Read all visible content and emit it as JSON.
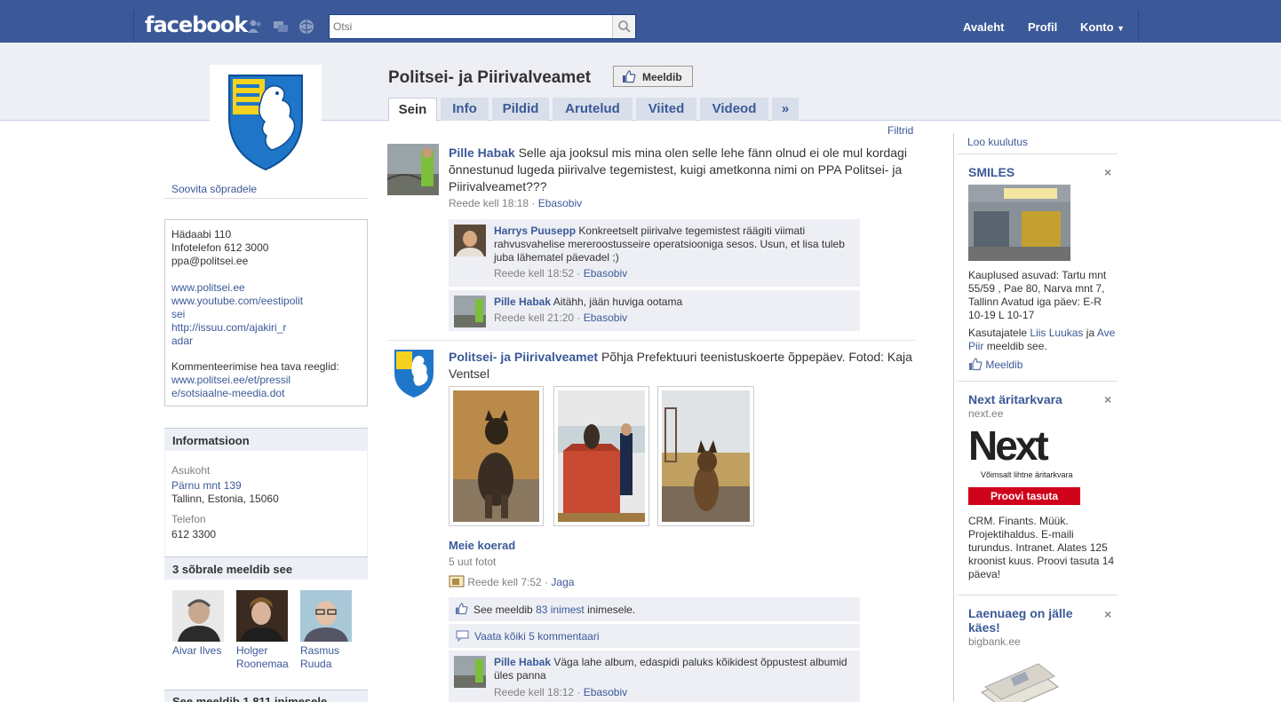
{
  "topbar": {
    "logo": "facebook",
    "search_placeholder": "Otsi",
    "nav": [
      "Avaleht",
      "Profil",
      "Konto"
    ]
  },
  "page": {
    "title": "Politsei- ja Piirivalveamet",
    "like_label": "Meeldib",
    "tabs": [
      "Sein",
      "Info",
      "Pildid",
      "Arutelud",
      "Viited",
      "Videod"
    ],
    "more_tab": "»",
    "filters": "Filtrid"
  },
  "left": {
    "suggest": "Soovita sõpradele",
    "contact": {
      "line1": "Hädaabi 110",
      "line2": "Infotelefon 612 3000",
      "line3": "ppa@politsei.ee",
      "link1": "www.politsei.ee",
      "link2a": "www.youtube.com/eestipolit",
      "link2b": "sei",
      "link3a": "http://issuu.com/ajakiri_r",
      "link3b": "adar",
      "rules_label": "Kommenteerimise hea tava reeglid:",
      "link4a": "www.politsei.ee/et/pressil",
      "link4b": "e/sotsiaalne-meedia.dot"
    },
    "info": {
      "heading": "Informatsioon",
      "location_label": "Asukoht",
      "street": "Pärnu mnt 139",
      "city": "Tallinn, Estonia, 15060",
      "phone_label": "Telefon",
      "phone": "612 3300"
    },
    "friends": {
      "heading": "3 sõbrale meeldib see",
      "people": [
        {
          "first": "Aivar Ilves",
          "second": ""
        },
        {
          "first": "Holger",
          "second": "Roonemaa"
        },
        {
          "first": "Rasmus",
          "second": "Ruuda"
        }
      ]
    },
    "likes_heading": "See meeldib 1 811 inimesele"
  },
  "feed": {
    "post1": {
      "author": "Pille Habak",
      "text": "Selle aja jooksul mis mina olen selle lehe fänn olnud ei ole mul kordagi õnnestunud lugeda piirivalve tegemistest, kuigi ametkonna nimi on PPA Politsei- ja Piirivalveamet???",
      "time": "Reede kell 18:18",
      "action": "Ebasobiv",
      "comments": [
        {
          "author": "Harrys Puusepp",
          "text": "Konkreetselt piirivalve tegemistest räägiti viimati rahvusvahelise mereroostusseire operatsiooniga sesos. Usun, et lisa tuleb juba lähematel päevadel ;)",
          "time": "Reede kell 18:52",
          "action": "Ebasobiv"
        },
        {
          "author": "Pille Habak",
          "text": "Aitähh, jään huviga ootama",
          "time": "Reede kell 21:20",
          "action": "Ebasobiv"
        }
      ]
    },
    "post2": {
      "author": "Politsei- ja Piirivalveamet",
      "text": "Põhja Prefektuuri teenistuskoerte õppepäev. Fotod: Kaja Ventsel",
      "album": "Meie koerad",
      "album_count": "5 uut fotot",
      "time": "Reede kell 7:52",
      "action": "Jaga",
      "likes_pre": "See meeldib",
      "likes_link": "83 inimest",
      "likes_post": "inimesele.",
      "view_comments": "Vaata kõiki 5 kommentaari",
      "comment": {
        "author": "Pille Habak",
        "text": "Väga lahe album, edaspidi paluks kõikidest õppustest albumid üles panna",
        "time": "Reede kell 18:12",
        "action": "Ebasobiv"
      }
    }
  },
  "ads": {
    "create": "Loo kuulutus",
    "ad1": {
      "title": "SMILES",
      "body": "Kauplused asuvad: Tartu mnt 55/59 , Pae 80, Narva mnt 7, Tallinn Avatud iga päev: E-R 10-19 L 10-17",
      "social_pre": "Kasutajatele",
      "social_name1": "Liis Luukas",
      "social_mid": "ja",
      "social_name2a": "Ave",
      "social_name2b": "Piir",
      "social_post": "meeldib see.",
      "like": "Meeldib"
    },
    "ad2": {
      "title": "Next äritarkvara",
      "url": "next.ee",
      "logo": "Next",
      "tagline": "Võimsalt lihtne äritarkvara",
      "cta": "Proovi tasuta",
      "body": "CRM. Finants. Müük. Projektihaldus. E-maili turundus. Intranet. Alates 125 kroonist kuus. Proovi tasuta 14 päeva!"
    },
    "ad3": {
      "title_line1": "Laenuaeg on jälle",
      "title_line2": "käes!",
      "url": "bigbank.ee"
    },
    "close": "×"
  },
  "colors": {
    "brand": "#3b5998",
    "band": "#edeff4",
    "next_red": "#d0021b"
  }
}
